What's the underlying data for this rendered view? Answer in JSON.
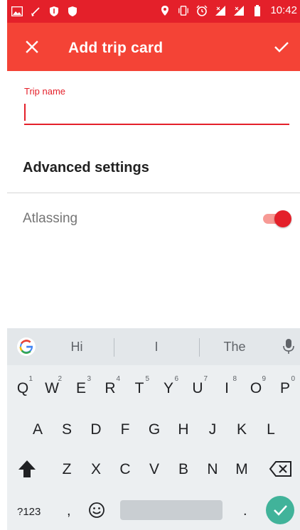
{
  "status_bar": {
    "time": "10:42"
  },
  "app_bar": {
    "title": "Add trip card",
    "close_icon": "close-icon",
    "confirm_icon": "check-icon",
    "color": "#f44336"
  },
  "form": {
    "trip_name_label": "Trip name",
    "trip_name_value": "",
    "advanced_settings": "Advanced settings",
    "atlassing_label": "Atlassing",
    "atlassing_on": true
  },
  "keyboard": {
    "suggestions": [
      "Hi",
      "I",
      "The"
    ],
    "row1": [
      {
        "k": "Q",
        "h": "1"
      },
      {
        "k": "W",
        "h": "2"
      },
      {
        "k": "E",
        "h": "3"
      },
      {
        "k": "R",
        "h": "4"
      },
      {
        "k": "T",
        "h": "5"
      },
      {
        "k": "Y",
        "h": "6"
      },
      {
        "k": "U",
        "h": "7"
      },
      {
        "k": "I",
        "h": "8"
      },
      {
        "k": "O",
        "h": "9"
      },
      {
        "k": "P",
        "h": "0"
      }
    ],
    "row2": [
      "A",
      "S",
      "D",
      "F",
      "G",
      "H",
      "J",
      "K",
      "L"
    ],
    "row3": [
      "Z",
      "X",
      "C",
      "V",
      "B",
      "N",
      "M"
    ],
    "num_label": "?123",
    "comma": ",",
    "period": "."
  },
  "colors": {
    "accent": "#e4202a",
    "switch_track": "#f79a95",
    "enter": "#41b39a",
    "keyboard_bg": "#eceff1"
  }
}
